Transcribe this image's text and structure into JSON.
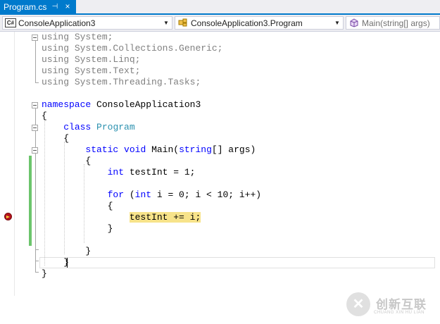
{
  "tab": {
    "title": "Program.cs",
    "pin_glyph": "⊣",
    "close_glyph": "×"
  },
  "navbar": {
    "project": {
      "icon": "C#",
      "label": "ConsoleApplication3"
    },
    "type": {
      "icon": "class-icon",
      "label": "ConsoleApplication3.Program"
    },
    "member": {
      "icon": "method-icon",
      "label": "Main(string[] args)"
    }
  },
  "code": {
    "l1": [
      "using",
      " System;"
    ],
    "l2": [
      "using",
      " System.Collections.Generic;"
    ],
    "l3": [
      "using",
      " System.Linq;"
    ],
    "l4": [
      "using",
      " System.Text;"
    ],
    "l5": [
      "using",
      " System.Threading.Tasks;"
    ],
    "l7": [
      "namespace",
      " ConsoleApplication3"
    ],
    "l8": "{",
    "l9": [
      "    ",
      "class",
      " ",
      "Program"
    ],
    "l10": "    {",
    "l11": [
      "        ",
      "static",
      " ",
      "void",
      " Main(",
      "string",
      "[] args)"
    ],
    "l12": "        {",
    "l13": [
      "            ",
      "int",
      " testInt = 1;"
    ],
    "l15": [
      "            ",
      "for",
      " (",
      "int",
      " i = 0; i < 10; i++)"
    ],
    "l16": "            {",
    "l17": [
      "                ",
      "testInt += i;"
    ],
    "l18": "            }",
    "l20": "        }",
    "l21": "    }",
    "l22": "}"
  },
  "colors": {
    "tab_accent": "#007acc",
    "keyword": "#0000ff",
    "type": "#2b91af",
    "unused_using": "#808080",
    "breakpoint_highlight": "#f7e38a",
    "change_bar": "#6cc46c"
  },
  "watermark": {
    "icon": "logo-icon",
    "logo_glyph": "✕",
    "cn": "创新互联",
    "en": "CHUANG XIN HU LIAN"
  }
}
